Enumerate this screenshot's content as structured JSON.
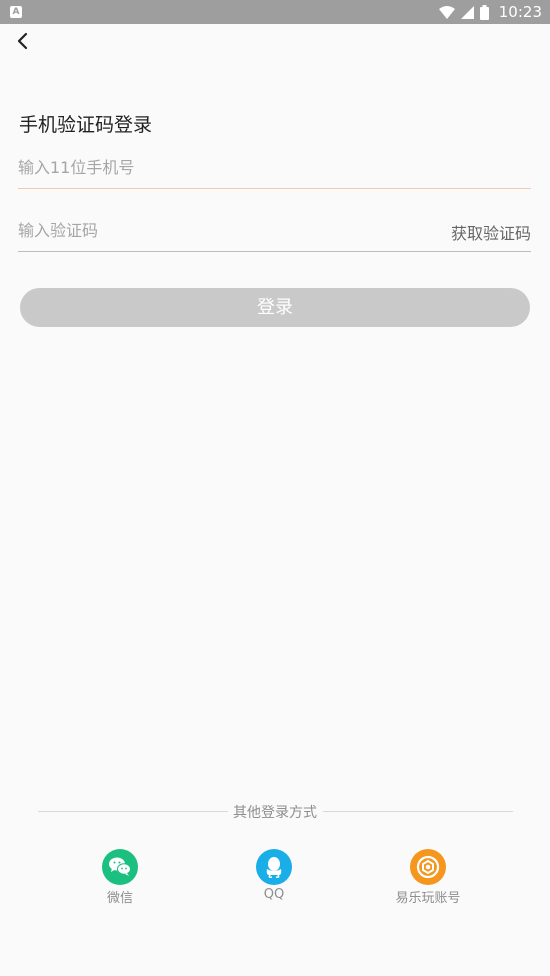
{
  "status_bar": {
    "time": "10:23",
    "app_badge": "A"
  },
  "login": {
    "title": "手机验证码登录",
    "phone_placeholder": "输入11位手机号",
    "code_placeholder": "输入验证码",
    "get_code_label": "获取验证码",
    "login_button": "登录"
  },
  "other_login": {
    "heading": "其他登录方式",
    "options": [
      {
        "label": "微信",
        "icon": "wechat-icon",
        "color": "#1bbf7f"
      },
      {
        "label": "QQ",
        "icon": "qq-icon",
        "color": "#1aaee8"
      },
      {
        "label": "易乐玩账号",
        "icon": "yilewan-icon",
        "color": "#f5961e"
      }
    ]
  },
  "colors": {
    "accent_underline": "#f4c9ae",
    "button_disabled": "#c9c9c9"
  }
}
